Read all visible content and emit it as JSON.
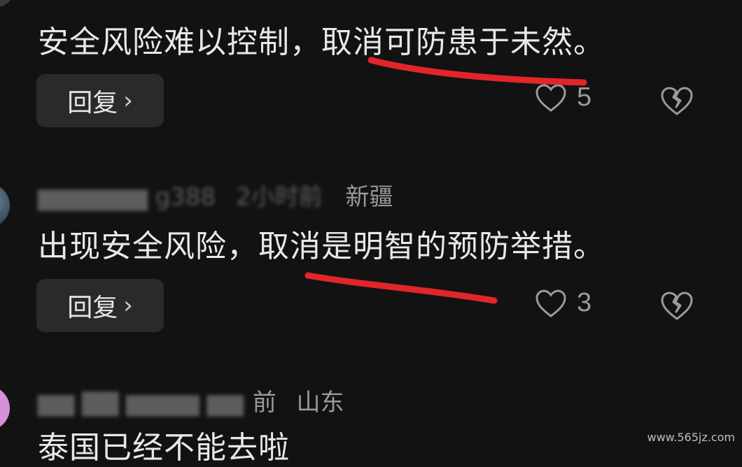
{
  "comments": [
    {
      "text": "安全风险难以控制，取消可防患于未然。",
      "reply_label": "回复",
      "likes": "5"
    },
    {
      "username_blurred": "g388",
      "time_blurred": "2小时前",
      "location": "新疆",
      "text": "出现安全风险，取消是明智的预防举措。",
      "reply_label": "回复",
      "likes": "3"
    },
    {
      "time_suffix": "前",
      "location": "山东",
      "text": "泰国已经不能去啦"
    }
  ],
  "watermark": "www.565jz.com",
  "colors": {
    "background": "#121213",
    "annotation_red": "#e0262a",
    "avatar_pink": "#d68fd8"
  }
}
